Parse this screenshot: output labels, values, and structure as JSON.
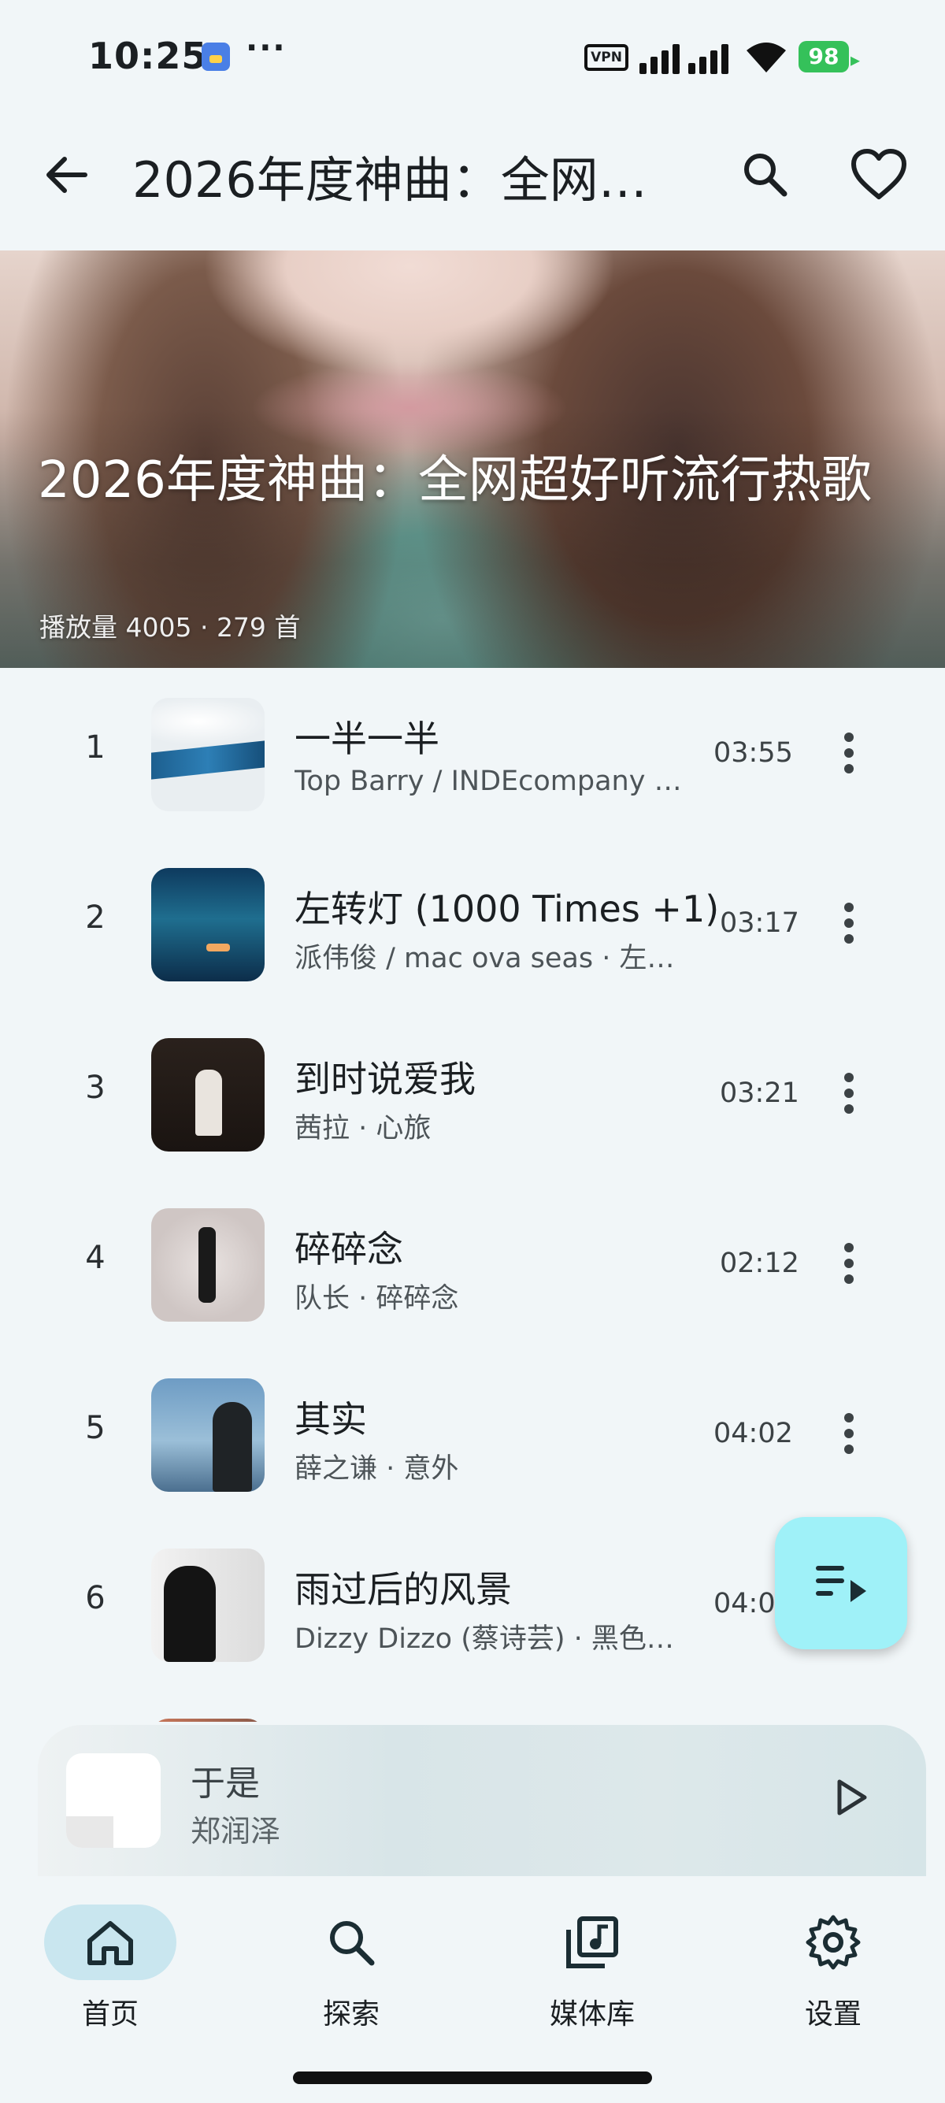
{
  "status_bar": {
    "time": "10:25",
    "more": "···",
    "vpn": "VPN",
    "battery": "98"
  },
  "appbar": {
    "title": "2026年度神曲：全网…"
  },
  "hero": {
    "title": "2026年度神曲：全网超好听流行热歌",
    "meta": "播放量 4005 · 279 首"
  },
  "songs": [
    {
      "index": "1",
      "title": "一半一半",
      "subtitle": "Top Barry / INDEcompany …",
      "duration": "03:55"
    },
    {
      "index": "2",
      "title": "左转灯 (1000 Times +1)",
      "subtitle": "派伟俊 / mac ova seas · 左…",
      "duration": "03:17"
    },
    {
      "index": "3",
      "title": "到时说爱我",
      "subtitle": "茜拉 · 心旅",
      "duration": "03:21"
    },
    {
      "index": "4",
      "title": "碎碎念",
      "subtitle": "队长 · 碎碎念",
      "duration": "02:12"
    },
    {
      "index": "5",
      "title": "其实",
      "subtitle": "薛之谦 · 意外",
      "duration": "04:02"
    },
    {
      "index": "6",
      "title": "雨过后的风景",
      "subtitle": "Dizzy Dizzo (蔡诗芸) · 黑色…",
      "duration": "04:0"
    }
  ],
  "mini_player": {
    "title": "于是",
    "artist": "郑润泽"
  },
  "nav": {
    "items": [
      {
        "label": "首页",
        "icon": "home-icon",
        "active": true
      },
      {
        "label": "探索",
        "icon": "search-icon",
        "active": false
      },
      {
        "label": "媒体库",
        "icon": "library-music-icon",
        "active": false
      },
      {
        "label": "设置",
        "icon": "gear-icon",
        "active": false
      }
    ]
  },
  "colors": {
    "background": "#f1f6f8",
    "fab": "#9ff1f8",
    "nav_active": "#c9e6ef",
    "battery": "#35c15a"
  }
}
